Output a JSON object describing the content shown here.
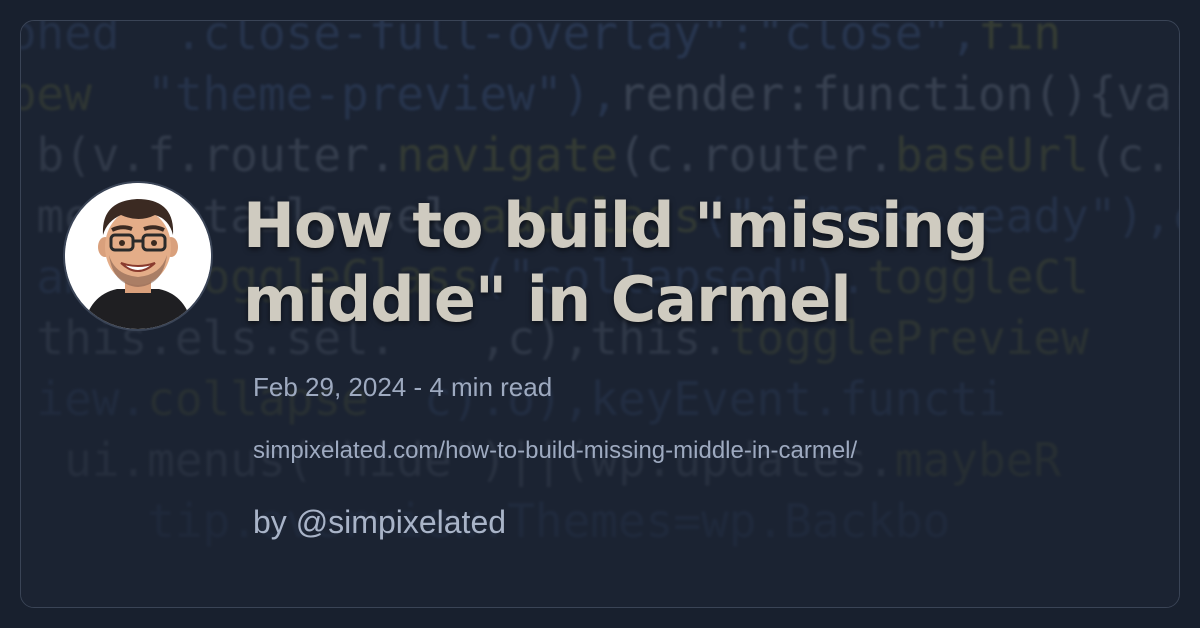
{
  "card": {
    "title": "How to build \"missing middle\" in Carmel",
    "date": "Feb 29, 2024",
    "separator": " - ",
    "read_time": "4 min read",
    "url": "simpixelated.com/how-to-build-missing-middle-in-carmel/",
    "byline": "by @simpixelated"
  },
  "avatar": {
    "icon": "cartoon-avatar-icon"
  },
  "colors": {
    "page_background": "#18202e",
    "card_background": "#1b2332",
    "title": "#cfcbc0",
    "meta": "#9eaac0",
    "border": "#3a4456"
  }
}
